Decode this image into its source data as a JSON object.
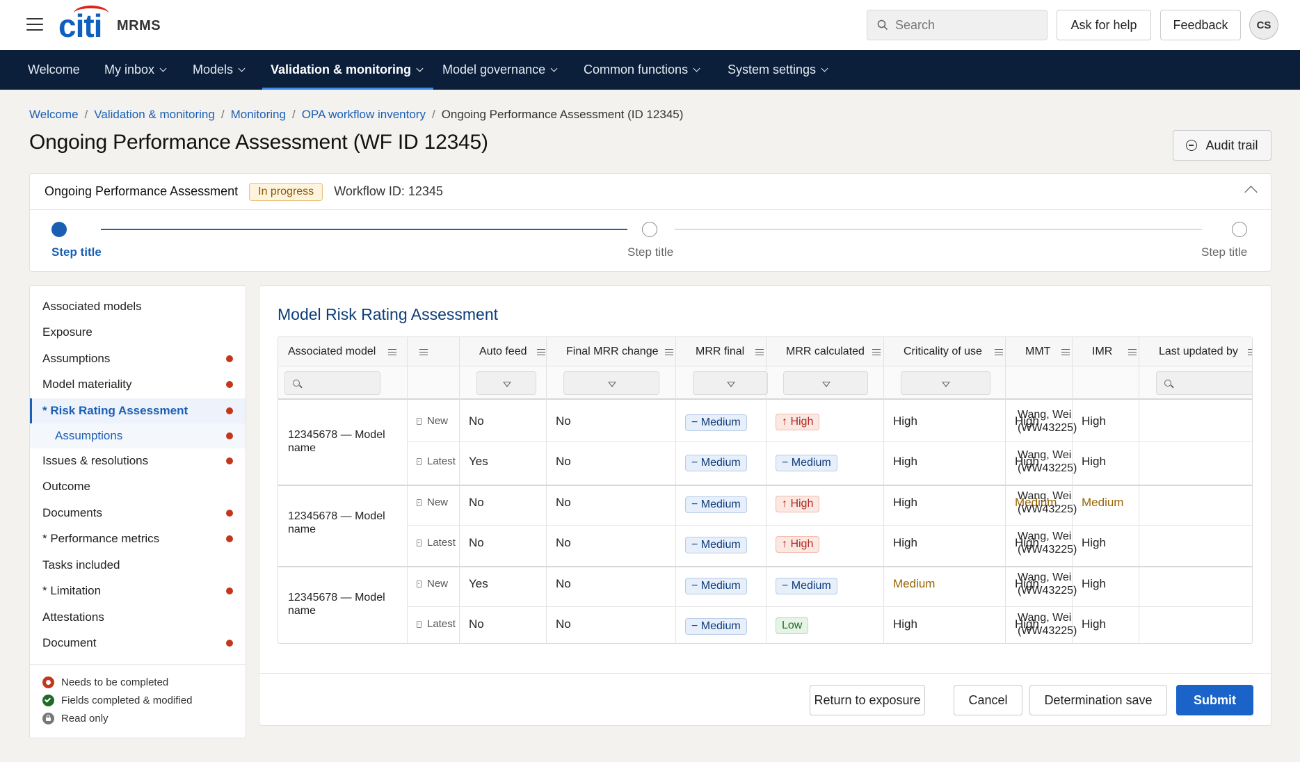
{
  "header": {
    "logo": "citi",
    "app_name": "MRMS",
    "search_placeholder": "Search",
    "help_label": "Ask for help",
    "feedback_label": "Feedback",
    "avatar_initials": "CS"
  },
  "nav": {
    "items": [
      {
        "label": "Welcome"
      },
      {
        "label": "My inbox"
      },
      {
        "label": "Models"
      },
      {
        "label": "Validation & monitoring"
      },
      {
        "label": "Model governance"
      },
      {
        "label": "Common functions"
      },
      {
        "label": "System settings"
      }
    ]
  },
  "breadcrumb": {
    "items": [
      "Welcome",
      "Validation & monitoring",
      "Monitoring",
      "OPA workflow inventory"
    ],
    "current": "Ongoing Performance Assessment (ID 12345)"
  },
  "page": {
    "title": "Ongoing Performance Assessment (WF ID 12345)",
    "audit_label": "Audit trail"
  },
  "workflow": {
    "title": "Ongoing Performance Assessment",
    "status": "In progress",
    "workflow_id": "Workflow ID: 12345",
    "steps": [
      "Step title",
      "Step title",
      "Step title"
    ]
  },
  "sidebar": {
    "items": [
      {
        "label": "Associated models"
      },
      {
        "label": "Exposure"
      },
      {
        "label": "Assumptions"
      },
      {
        "label": "Model materiality"
      },
      {
        "label": "* Risk Rating Assessment"
      },
      {
        "label": "Assumptions"
      },
      {
        "label": "Issues & resolutions"
      },
      {
        "label": "Outcome"
      },
      {
        "label": "Documents"
      },
      {
        "label": "* Performance metrics"
      },
      {
        "label": "Tasks included"
      },
      {
        "label": "* Limitation"
      },
      {
        "label": "Attestations"
      },
      {
        "label": "Document"
      }
    ],
    "legend": [
      "Needs to be completed",
      "Fields completed & modified",
      "Read only"
    ]
  },
  "assessment": {
    "title": "Model Risk Rating Assessment",
    "columns": [
      "Associated model",
      "",
      "Auto feed",
      "Final MRR change",
      "MRR final",
      "MRR calculated",
      "Criticality of use",
      "MMT",
      "IMR",
      "Last updated by"
    ],
    "groups": [
      {
        "model": "12345678 — Model name",
        "rows": [
          {
            "version": "New",
            "auto_feed": "No",
            "final_change": "No",
            "mrr_final": "− Medium",
            "mrr_calc": "↑ High",
            "criticality": "High",
            "mmt": "High",
            "imr": "High",
            "updated": "Wang, Wei",
            "updated_id": "(WW43225)"
          },
          {
            "version": "Latest",
            "auto_feed": "Yes",
            "final_change": "No",
            "mrr_final": "− Medium",
            "mrr_calc": "− Medium",
            "criticality": "High",
            "mmt": "High",
            "imr": "High",
            "updated": "Wang, Wei",
            "updated_id": "(WW43225)"
          }
        ]
      },
      {
        "model": "12345678 — Model name",
        "rows": [
          {
            "version": "New",
            "auto_feed": "No",
            "final_change": "No",
            "mrr_final": "− Medium",
            "mrr_calc": "↑ High",
            "criticality": "High",
            "mmt": "Medium",
            "imr": "Medium",
            "updated": "Wang, Wei",
            "updated_id": "(WW43225)"
          },
          {
            "version": "Latest",
            "auto_feed": "No",
            "final_change": "No",
            "mrr_final": "− Medium",
            "mrr_calc": "↑ High",
            "criticality": "High",
            "mmt": "High",
            "imr": "High",
            "updated": "Wang, Wei",
            "updated_id": "(WW43225)"
          }
        ]
      },
      {
        "model": "12345678 — Model name",
        "rows": [
          {
            "version": "New",
            "auto_feed": "Yes",
            "final_change": "No",
            "mrr_final": "− Medium",
            "mrr_calc": "− Medium",
            "criticality": "Medium",
            "mmt": "High",
            "imr": "High",
            "updated": "Wang, Wei",
            "updated_id": "(WW43225)"
          },
          {
            "version": "Latest",
            "auto_feed": "No",
            "final_change": "No",
            "mrr_final": "− Medium",
            "mrr_calc": "Low",
            "criticality": "High",
            "mmt": "High",
            "imr": "High",
            "updated": "Wang, Wei",
            "updated_id": "(WW43225)"
          }
        ]
      }
    ]
  },
  "footer": {
    "return_label": "Return to exposure",
    "cancel_label": "Cancel",
    "save_label": "Determination save",
    "submit_label": "Submit"
  },
  "colors": {
    "accent": "#1a63c9",
    "nav_bg": "#0b1f3a",
    "brand_blue": "#0f5fbf",
    "brand_red": "#d9251c",
    "required_dot": "#c2361b"
  }
}
